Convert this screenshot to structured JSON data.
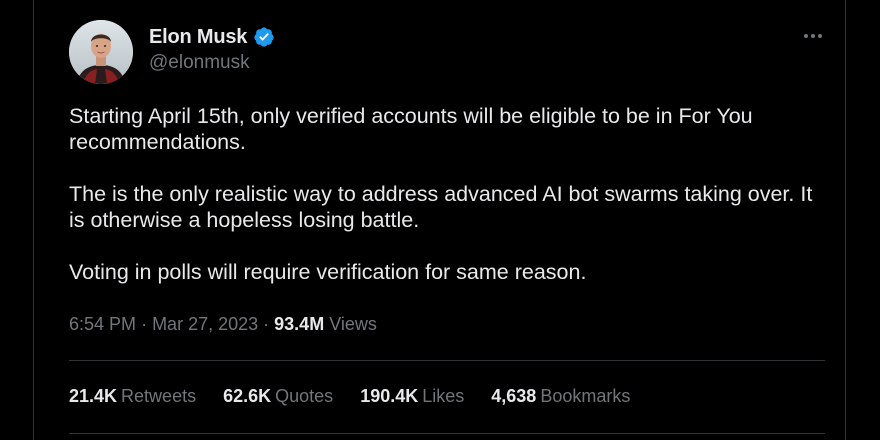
{
  "author": {
    "name": "Elon Musk",
    "handle": "@elonmusk",
    "verified": true,
    "avatar_icon": "profile-photo"
  },
  "tweet": {
    "paragraphs": [
      "Starting April 15th, only verified accounts will be eligible to be in For You recommendations.",
      "The is the only realistic way to address advanced AI bot swarms taking over. It is otherwise a hopeless losing battle.",
      "Voting in polls will require verification for same reason."
    ],
    "time": "6:54 PM",
    "date": "Mar 27, 2023",
    "views_count": "93.4M",
    "views_label": "Views"
  },
  "stats": {
    "retweets_count": "21.4K",
    "retweets_label": "Retweets",
    "quotes_count": "62.6K",
    "quotes_label": "Quotes",
    "likes_count": "190.4K",
    "likes_label": "Likes",
    "bookmarks_count": "4,638",
    "bookmarks_label": "Bookmarks"
  },
  "colors": {
    "background": "#000000",
    "text_primary": "#e7e9ea",
    "text_secondary": "#71767b",
    "border": "#2f3336",
    "verified_blue": "#1d9bf0"
  },
  "icons": {
    "verified": "verified-badge-icon",
    "more": "more-horizontal-icon"
  }
}
